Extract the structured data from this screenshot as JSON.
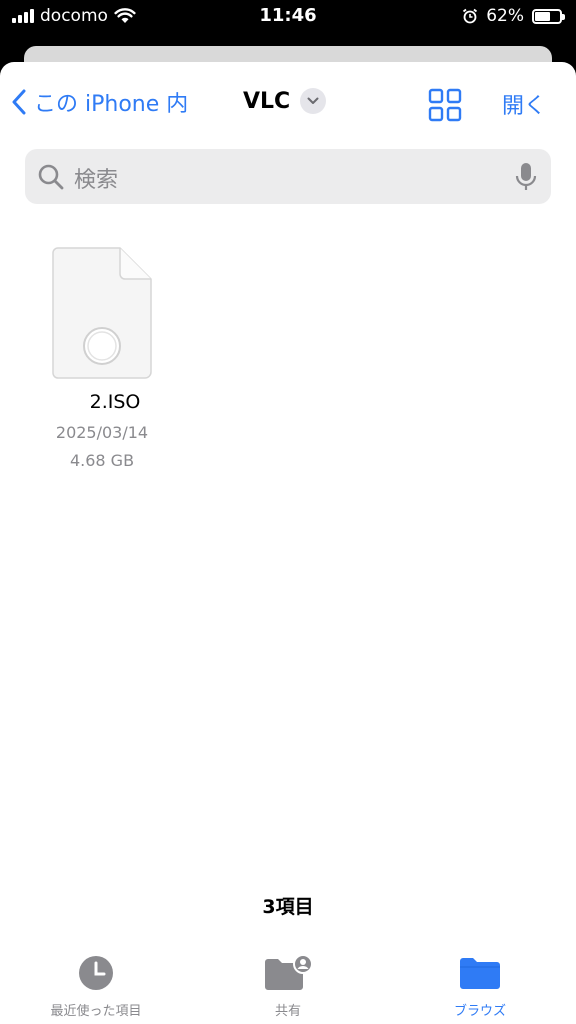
{
  "status_bar": {
    "carrier": "docomo",
    "time": "11:46",
    "battery_percent": "62%",
    "battery_level": 0.62
  },
  "navbar": {
    "back_label": "この iPhone 内",
    "title": "VLC",
    "open_label": "開く"
  },
  "search": {
    "placeholder": "検索"
  },
  "files": [
    {
      "name": "2.ISO",
      "date": "2025/03/14",
      "size": "4.68 GB",
      "icon": "generic-document-icon"
    }
  ],
  "item_count": "3項目",
  "tabs": [
    {
      "label": "最近使った項目",
      "icon": "clock-icon",
      "active": false
    },
    {
      "label": "共有",
      "icon": "shared-folder-icon",
      "active": false
    },
    {
      "label": "ブラウズ",
      "icon": "folder-icon",
      "active": true
    }
  ],
  "colors": {
    "accent": "#2f7bf5",
    "secondary_text": "#8a8a8e"
  }
}
